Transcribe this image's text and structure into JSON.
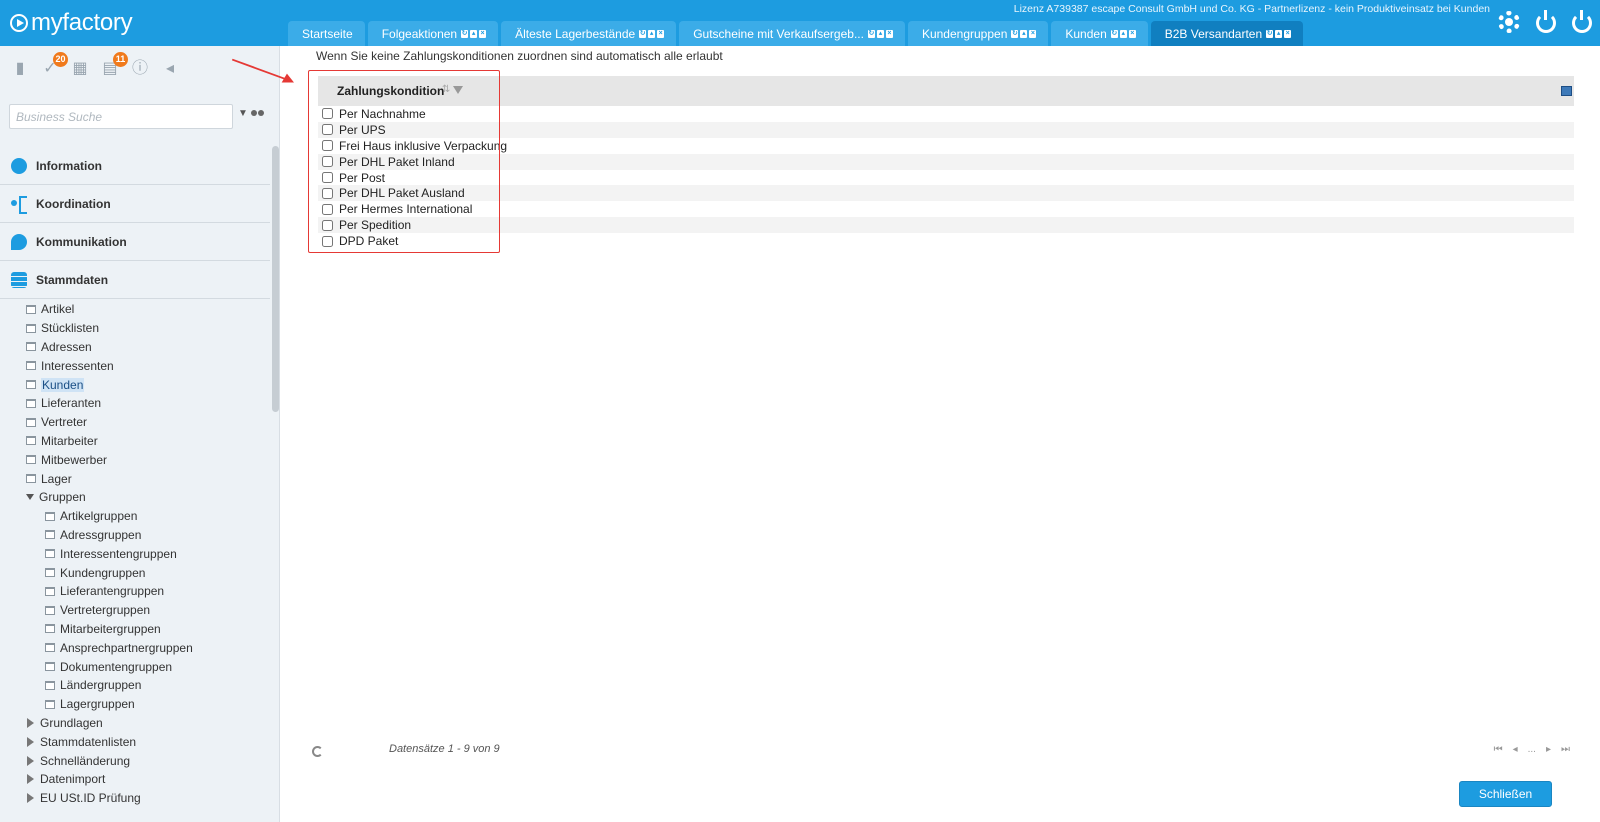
{
  "app": {
    "logo": "myfactory",
    "license": "Lizenz A739387 escape Consult GmbH und Co. KG - Partnerlizenz - kein Produktiveinsatz bei Kunden"
  },
  "tabs": [
    {
      "label": "Startseite",
      "controls": false,
      "active": false
    },
    {
      "label": "Folgeaktionen",
      "controls": true,
      "active": false
    },
    {
      "label": "Älteste Lagerbestände",
      "controls": true,
      "active": false
    },
    {
      "label": "Gutscheine mit Verkaufsergeb...",
      "controls": true,
      "active": false
    },
    {
      "label": "Kundengruppen",
      "controls": true,
      "active": false
    },
    {
      "label": "Kunden",
      "controls": true,
      "active": false
    },
    {
      "label": "B2B Versandarten",
      "controls": true,
      "active": true
    }
  ],
  "sidebar": {
    "badges": {
      "tasks": "20",
      "messages": "11"
    },
    "search_placeholder": "Business Suche",
    "sections": [
      "Information",
      "Koordination",
      "Kommunikation",
      "Stammdaten"
    ],
    "tree": [
      {
        "label": "Artikel",
        "level": 1,
        "type": "leaf"
      },
      {
        "label": "Stücklisten",
        "level": 1,
        "type": "leaf"
      },
      {
        "label": "Adressen",
        "level": 1,
        "type": "leaf"
      },
      {
        "label": "Interessenten",
        "level": 1,
        "type": "leaf"
      },
      {
        "label": "Kunden",
        "level": 1,
        "type": "leaf",
        "selected": true
      },
      {
        "label": "Lieferanten",
        "level": 1,
        "type": "leaf"
      },
      {
        "label": "Vertreter",
        "level": 1,
        "type": "leaf"
      },
      {
        "label": "Mitarbeiter",
        "level": 1,
        "type": "leaf"
      },
      {
        "label": "Mitbewerber",
        "level": 1,
        "type": "leaf"
      },
      {
        "label": "Lager",
        "level": 1,
        "type": "leaf"
      },
      {
        "label": "Gruppen",
        "level": 1,
        "type": "expanded"
      },
      {
        "label": "Artikelgruppen",
        "level": 2,
        "type": "leaf"
      },
      {
        "label": "Adressgruppen",
        "level": 2,
        "type": "leaf"
      },
      {
        "label": "Interessentengruppen",
        "level": 2,
        "type": "leaf"
      },
      {
        "label": "Kundengruppen",
        "level": 2,
        "type": "leaf"
      },
      {
        "label": "Lieferantengruppen",
        "level": 2,
        "type": "leaf"
      },
      {
        "label": "Vertretergruppen",
        "level": 2,
        "type": "leaf"
      },
      {
        "label": "Mitarbeitergruppen",
        "level": 2,
        "type": "leaf"
      },
      {
        "label": "Ansprechpartnergruppen",
        "level": 2,
        "type": "leaf"
      },
      {
        "label": "Dokumentengruppen",
        "level": 2,
        "type": "leaf"
      },
      {
        "label": "Ländergruppen",
        "level": 2,
        "type": "leaf"
      },
      {
        "label": "Lagergruppen",
        "level": 2,
        "type": "leaf"
      },
      {
        "label": "Grundlagen",
        "level": 1,
        "type": "collapsed"
      },
      {
        "label": "Stammdatenlisten",
        "level": 1,
        "type": "collapsed"
      },
      {
        "label": "Schnelländerung",
        "level": 1,
        "type": "collapsed"
      },
      {
        "label": "Datenimport",
        "level": 1,
        "type": "collapsed"
      },
      {
        "label": "EU USt.ID Prüfung",
        "level": 1,
        "type": "collapsed"
      }
    ]
  },
  "main": {
    "hint": "Wenn Sie keine Zahlungskonditionen zuordnen sind automatisch alle erlaubt",
    "column_header": "Zahlungskondition",
    "rows": [
      {
        "label": "Per Nachnahme",
        "checked": false
      },
      {
        "label": "Per UPS",
        "checked": false
      },
      {
        "label": "Frei Haus inklusive Verpackung",
        "checked": false
      },
      {
        "label": "Per DHL Paket Inland",
        "checked": false
      },
      {
        "label": "Per Post",
        "checked": false
      },
      {
        "label": "Per DHL Paket Ausland",
        "checked": false
      },
      {
        "label": "Per Hermes International",
        "checked": false
      },
      {
        "label": "Per Spedition",
        "checked": false
      },
      {
        "label": "DPD Paket",
        "checked": false
      }
    ],
    "records_info": "Datensätze 1 - 9 von 9",
    "pager": {
      "first": "⏮",
      "prev": "◂",
      "ellipsis": "...",
      "next": "▸",
      "last": "⏭"
    },
    "close_label": "Schließen"
  },
  "colors": {
    "brand": "#1d9ce0",
    "active_tab": "#107fc0",
    "badge": "#f07a1c",
    "highlight": "#e53935"
  }
}
